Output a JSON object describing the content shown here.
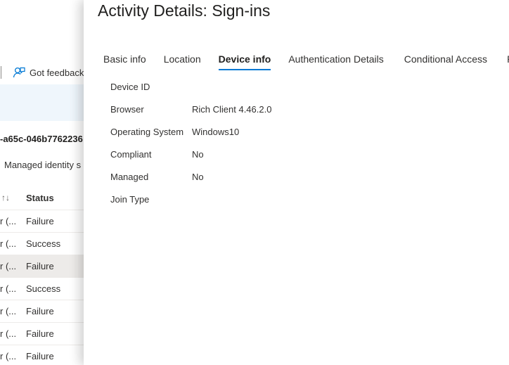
{
  "background": {
    "toolbar": {
      "feedback_label": "Got feedback"
    },
    "request_id": "-a65c-046b7762236",
    "filter_label": "Managed identity s",
    "table": {
      "sort_glyph": "↑↓",
      "status_header": "Status",
      "rows": [
        {
          "col1": "r (...",
          "status": "Failure",
          "selected": false
        },
        {
          "col1": "r (...",
          "status": "Success",
          "selected": false
        },
        {
          "col1": "r (...",
          "status": "Failure",
          "selected": true
        },
        {
          "col1": "r (...",
          "status": "Success",
          "selected": false
        },
        {
          "col1": "r (...",
          "status": "Failure",
          "selected": false
        },
        {
          "col1": "r (...",
          "status": "Failure",
          "selected": false
        },
        {
          "col1": "r (...",
          "status": "Failure",
          "selected": false
        }
      ]
    }
  },
  "panel": {
    "title": "Activity Details: Sign-ins",
    "tabs": [
      {
        "label": "Basic info",
        "active": false
      },
      {
        "label": "Location",
        "active": false
      },
      {
        "label": "Device info",
        "active": true
      },
      {
        "label": "Authentication Details",
        "active": false
      },
      {
        "label": "Conditional Access",
        "active": false
      },
      {
        "label": "Re",
        "active": false
      }
    ],
    "device_info": [
      {
        "key": "Device ID",
        "value": ""
      },
      {
        "key": "Browser",
        "value": "Rich Client 4.46.2.0"
      },
      {
        "key": "Operating System",
        "value": "Windows10"
      },
      {
        "key": "Compliant",
        "value": "No"
      },
      {
        "key": "Managed",
        "value": "No"
      },
      {
        "key": "Join Type",
        "value": ""
      }
    ]
  },
  "colors": {
    "accent": "#0078d4",
    "selected_row": "#edebe9",
    "band": "#eff6fc"
  }
}
